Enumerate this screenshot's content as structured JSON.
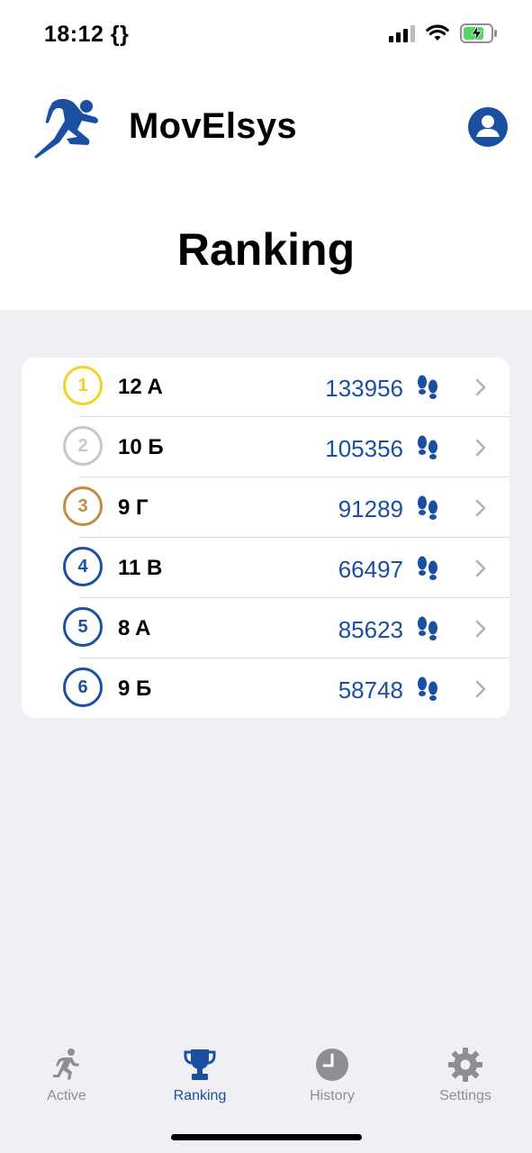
{
  "status_bar": {
    "time": "18:12 {}"
  },
  "header": {
    "app_name": "MovElsys",
    "logo_icon": "runner-logo-icon",
    "profile_icon": "person-circle-icon"
  },
  "page_title": "Ranking",
  "colors": {
    "accent": "#1a4fa1",
    "gold": "#f3d223",
    "silver": "#c7c7c7",
    "bronze": "#c48a3d",
    "background": "#efeff4"
  },
  "ranking": [
    {
      "rank": "1",
      "name": "12 A",
      "steps": "133956",
      "medal": "gold"
    },
    {
      "rank": "2",
      "name": "10 Б",
      "steps": "105356",
      "medal": "silver"
    },
    {
      "rank": "3",
      "name": "9 Г",
      "steps": "91289",
      "medal": "bronze"
    },
    {
      "rank": "4",
      "name": "11 В",
      "steps": "66497",
      "medal": "accent"
    },
    {
      "rank": "5",
      "name": "8 A",
      "steps": "85623",
      "medal": "accent"
    },
    {
      "rank": "6",
      "name": "9 Б",
      "steps": "58748",
      "medal": "accent"
    }
  ],
  "tabs": [
    {
      "label": "Active",
      "icon": "runner-icon",
      "active": false
    },
    {
      "label": "Ranking",
      "icon": "trophy-icon",
      "active": true
    },
    {
      "label": "History",
      "icon": "clock-icon",
      "active": false
    },
    {
      "label": "Settings",
      "icon": "gear-icon",
      "active": false
    }
  ]
}
